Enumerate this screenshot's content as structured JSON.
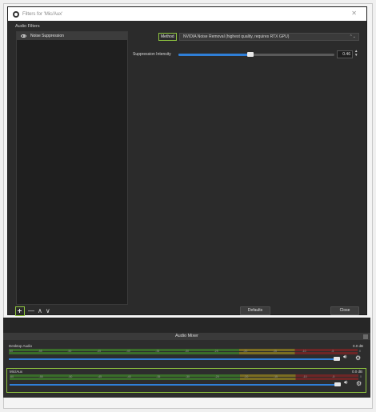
{
  "dialog": {
    "title": "Filters for 'Mic/Aux'",
    "section_label": "Audio Filters",
    "filters": [
      {
        "name": "Noise Suppression",
        "visible": true,
        "icon": "eye-icon"
      }
    ],
    "properties": {
      "method_label": "Method",
      "method_value": "NVIDIA Noise Removal (highest quality, requires RTX GPU)",
      "intensity_label": "Suppression Intensity",
      "intensity_value": "0.46",
      "intensity_fraction": 0.46
    },
    "toolbar": {
      "add_icon": "plus-icon",
      "remove_glyph": "—",
      "up_glyph": "∧",
      "down_glyph": "∨"
    },
    "buttons": {
      "defaults": "Defaults",
      "close": "Close"
    }
  },
  "mixer": {
    "title": "Audio Mixer",
    "ticks": [
      "-60",
      "-55",
      "-50",
      "-45",
      "-40",
      "-35",
      "-30",
      "-25",
      "-20",
      "-15",
      "-10",
      "-5",
      "0"
    ],
    "channels": [
      {
        "name": "Desktop Audio",
        "db": "0.0 dB",
        "volume_fraction": 0.93,
        "highlight": false
      },
      {
        "name": "Mic/Aux",
        "db": "0.0 dB",
        "volume_fraction": 0.93,
        "highlight": true
      }
    ]
  },
  "colors": {
    "accent_highlight": "#8ec43f",
    "slider_blue": "#2f7fd8",
    "dialog_bg": "#2b2b2b"
  }
}
